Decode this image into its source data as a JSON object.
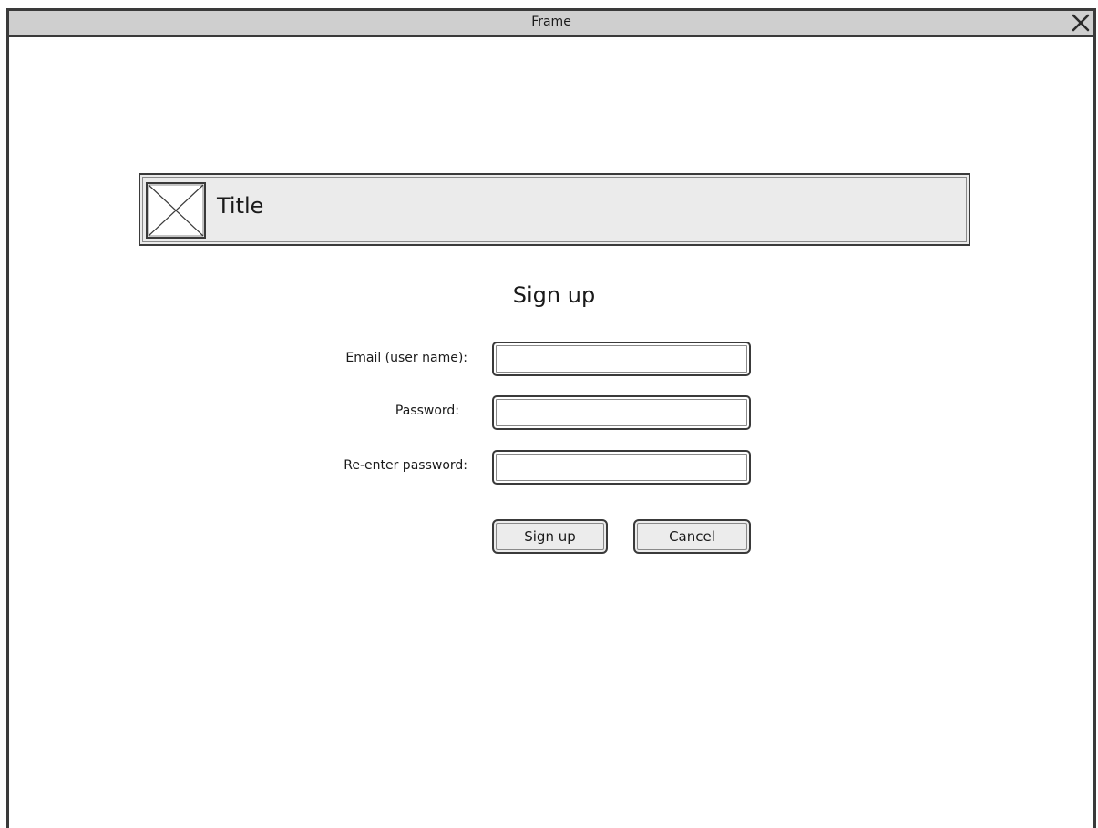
{
  "window": {
    "title": "Frame"
  },
  "header": {
    "title": "Title"
  },
  "form": {
    "heading": "Sign up",
    "email_label": "Email (user name):",
    "email_value": "",
    "password_label": "Password:",
    "password_value": "",
    "reenter_label": "Re-enter password:",
    "reenter_value": "",
    "signup_button": "Sign up",
    "cancel_button": "Cancel"
  },
  "icons": {
    "close": "close-icon",
    "logo": "image-placeholder-icon"
  },
  "colors": {
    "titlebar": "#cfcfcf",
    "header_bg": "#ebebeb",
    "border": "#3a3a3a",
    "button_bg": "#ececec"
  }
}
